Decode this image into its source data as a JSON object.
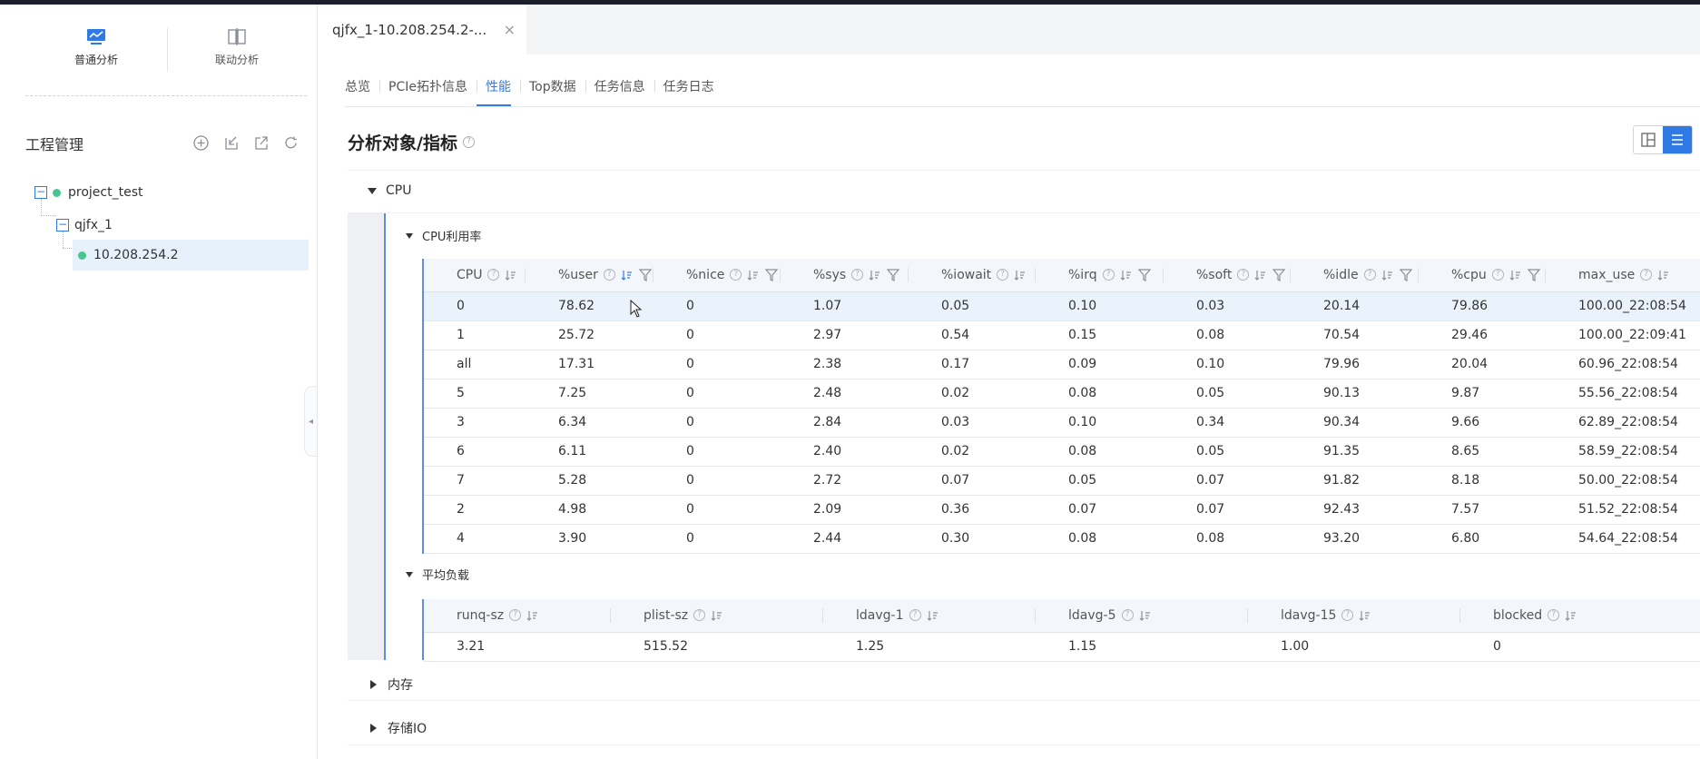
{
  "sidebar": {
    "modes": [
      {
        "label": "普通分析",
        "icon": "chart-icon",
        "active": true
      },
      {
        "label": "联动分析",
        "icon": "split-view-icon",
        "active": false
      }
    ],
    "project_management_title": "工程管理",
    "actions": [
      "add-icon",
      "import-icon",
      "export-icon",
      "refresh-icon"
    ],
    "tree": {
      "project": "project_test",
      "task": "qjfx_1",
      "node": "10.208.254.2"
    }
  },
  "main": {
    "file_tab": {
      "label": "qjfx_1-10.208.254.2-...",
      "close": "×"
    },
    "sub_tabs": [
      "总览",
      "PCIe拓扑信息",
      "性能",
      "Top数据",
      "任务信息",
      "任务日志"
    ],
    "active_sub_tab": "性能",
    "section_title": "分析对象/指标",
    "help_glyph": "?",
    "groups": {
      "cpu": "CPU",
      "memory": "内存",
      "storage": "存储IO"
    },
    "cpu_usage": {
      "title": "CPU利用率",
      "columns": [
        "CPU",
        "%user",
        "%nice",
        "%sys",
        "%iowait",
        "%irq",
        "%soft",
        "%idle",
        "%cpu",
        "max_use"
      ],
      "rows": [
        [
          "0",
          "78.62",
          "0",
          "1.07",
          "0.05",
          "0.10",
          "0.03",
          "20.14",
          "79.86",
          "100.00_22:08:54"
        ],
        [
          "1",
          "25.72",
          "0",
          "2.97",
          "0.54",
          "0.15",
          "0.08",
          "70.54",
          "29.46",
          "100.00_22:09:41"
        ],
        [
          "all",
          "17.31",
          "0",
          "2.38",
          "0.17",
          "0.09",
          "0.10",
          "79.96",
          "20.04",
          "60.96_22:08:54"
        ],
        [
          "5",
          "7.25",
          "0",
          "2.48",
          "0.02",
          "0.08",
          "0.05",
          "90.13",
          "9.87",
          "55.56_22:08:54"
        ],
        [
          "3",
          "6.34",
          "0",
          "2.84",
          "0.03",
          "0.10",
          "0.34",
          "90.34",
          "9.66",
          "62.89_22:08:54"
        ],
        [
          "6",
          "6.11",
          "0",
          "2.40",
          "0.02",
          "0.08",
          "0.05",
          "91.35",
          "8.65",
          "58.59_22:08:54"
        ],
        [
          "7",
          "5.28",
          "0",
          "2.72",
          "0.07",
          "0.05",
          "0.07",
          "91.82",
          "8.18",
          "50.00_22:08:54"
        ],
        [
          "2",
          "4.98",
          "0",
          "2.09",
          "0.36",
          "0.07",
          "0.07",
          "92.43",
          "7.57",
          "51.52_22:08:54"
        ],
        [
          "4",
          "3.90",
          "0",
          "2.44",
          "0.30",
          "0.08",
          "0.08",
          "93.20",
          "6.80",
          "54.64_22:08:54"
        ]
      ]
    },
    "avg_load": {
      "title": "平均负载",
      "columns": [
        "runq-sz",
        "plist-sz",
        "ldavg-1",
        "ldavg-5",
        "ldavg-15",
        "blocked"
      ],
      "rows": [
        [
          "3.21",
          "515.52",
          "1.25",
          "1.15",
          "1.00",
          "0"
        ]
      ]
    },
    "accent_color": "#2f7ae5",
    "status_color": "#47c690"
  }
}
